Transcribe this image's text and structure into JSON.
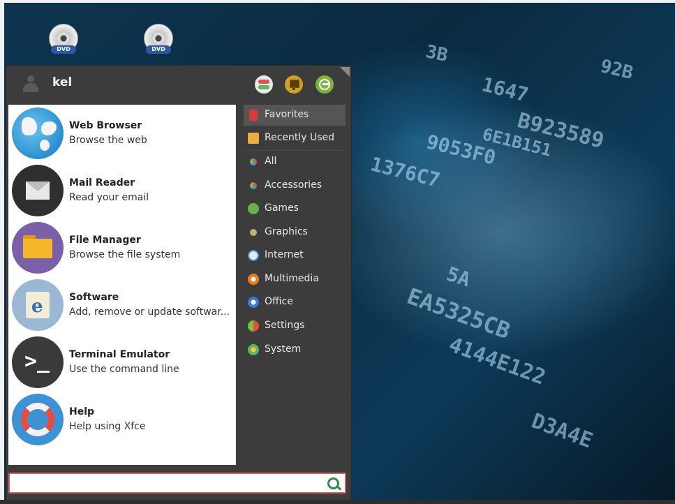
{
  "desktop": {
    "icons": [
      {
        "name": "dvd-drive-1",
        "label": "DVD"
      },
      {
        "name": "dvd-drive-2",
        "label": "DVD"
      }
    ],
    "wallpaper_glyphs": [
      "3B",
      "1647",
      "92B",
      "B923589",
      "9053F0",
      "6E1B151",
      "1376C7",
      "EA5325CB",
      "4144E122",
      "D3A4E",
      "5A"
    ]
  },
  "menu": {
    "user_name": "kel",
    "header_buttons": [
      "settings-manager",
      "lock-screen",
      "log-out"
    ],
    "favorites": [
      {
        "title": "Web Browser",
        "desc": "Browse the web",
        "icon": "globe-icon"
      },
      {
        "title": "Mail Reader",
        "desc": "Read your email",
        "icon": "envelope-icon"
      },
      {
        "title": "File Manager",
        "desc": "Browse the file system",
        "icon": "folder-icon"
      },
      {
        "title": "Software",
        "desc": "Add, remove or update softwar...",
        "icon": "software-bag-icon"
      },
      {
        "title": "Terminal Emulator",
        "desc": "Use the command line",
        "icon": "terminal-icon"
      },
      {
        "title": "Help",
        "desc": "Help using Xfce",
        "icon": "lifebuoy-icon"
      }
    ],
    "categories": [
      {
        "label": "Favorites",
        "selected": true
      },
      {
        "label": "Recently Used"
      },
      {
        "label": "All"
      },
      {
        "label": "Accessories"
      },
      {
        "label": "Games"
      },
      {
        "label": "Graphics"
      },
      {
        "label": "Internet"
      },
      {
        "label": "Multimedia"
      },
      {
        "label": "Office"
      },
      {
        "label": "Settings"
      },
      {
        "label": "System"
      }
    ],
    "search": {
      "value": "",
      "placeholder": ""
    }
  },
  "colors": {
    "menu_bg": "#3c3c3c",
    "selected_category": "#555555",
    "search_border": "#e05a5a",
    "search_icon": "#2e8b57"
  }
}
